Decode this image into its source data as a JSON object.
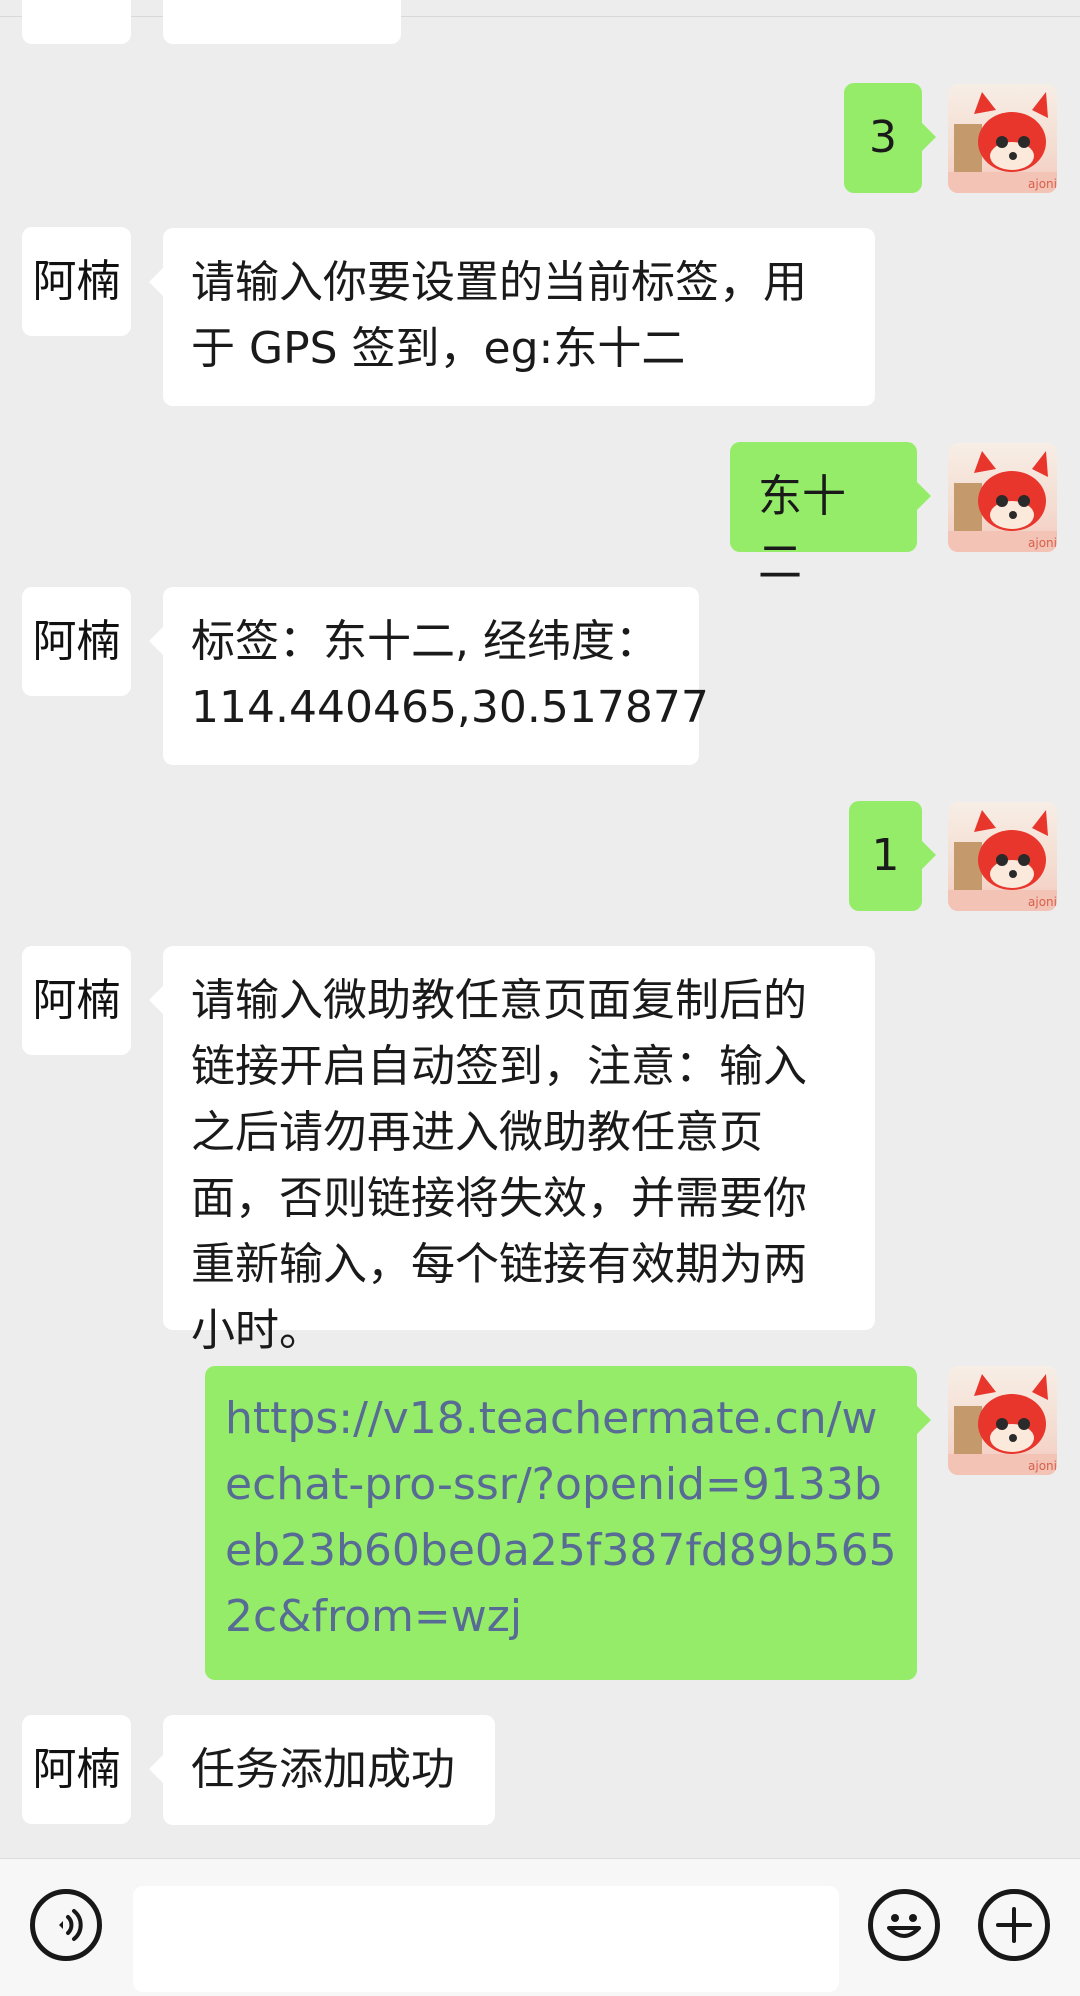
{
  "contact": {
    "name": "阿楠"
  },
  "messages": [
    {
      "from": "me",
      "text": "3"
    },
    {
      "from": "them",
      "text": "请输入你要设置的当前标签，用于 GPS 签到，eg:东十二"
    },
    {
      "from": "me",
      "text": "东十二"
    },
    {
      "from": "them",
      "text": "标签：东十二, 经纬度：114.440465,30.517877"
    },
    {
      "from": "me",
      "text": "1"
    },
    {
      "from": "them",
      "text": "请输入微助教任意页面复制后的链接开启自动签到，注意：输入之后请勿再进入微助教任意页面，否则链接将失效，并需要你重新输入，每个链接有效期为两小时。"
    },
    {
      "from": "me",
      "text": "https://v18.teachermate.cn/wechat-pro-ssr/?openid=9133beb23b60be0a25f387fd89b5652c&from=wzj"
    },
    {
      "from": "them",
      "text": "任务添加成功"
    }
  ],
  "input_bar": {
    "placeholder": ""
  },
  "icons": {
    "voice": "voice-icon",
    "emoji": "emoji-icon",
    "plus": "plus-icon",
    "avatar": "red-fox-avatar"
  },
  "colors": {
    "background": "#ededed",
    "bubble_in": "#ffffff",
    "bubble_out": "#95ec69",
    "link": "#576b95"
  }
}
